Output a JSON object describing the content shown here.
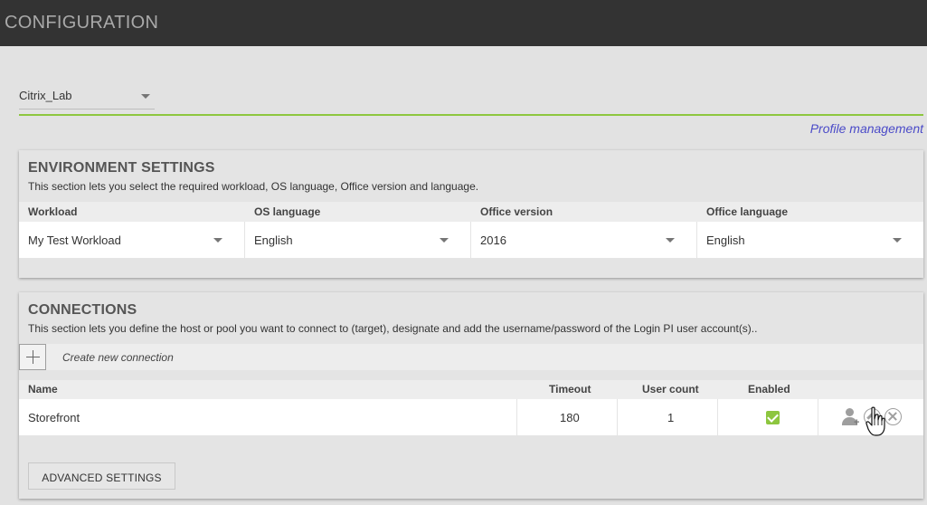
{
  "app": {
    "title": "CONFIGURATION"
  },
  "profile": {
    "selected": "Citrix_Lab",
    "management_link": "Profile management"
  },
  "environment": {
    "title": "ENVIRONMENT SETTINGS",
    "description": "This section lets you select the required workload, OS language, Office version and language.",
    "fields": [
      {
        "label": "Workload",
        "value": "My Test Workload"
      },
      {
        "label": "OS language",
        "value": "English"
      },
      {
        "label": "Office version",
        "value": "2016"
      },
      {
        "label": "Office language",
        "value": "English"
      }
    ]
  },
  "connections": {
    "title": "CONNECTIONS",
    "description": "This section lets you define the host or pool you want to connect to (target), designate and add the username/password of the Login PI user account(s)..",
    "create_label": "Create new connection",
    "columns": {
      "name": "Name",
      "timeout": "Timeout",
      "user_count": "User count",
      "enabled": "Enabled"
    },
    "rows": [
      {
        "name": "Storefront",
        "timeout": "180",
        "user_count": "1",
        "enabled": true
      }
    ],
    "advanced_label": "ADVANCED SETTINGS"
  },
  "icons": {
    "add": "plus-icon",
    "dropdown": "chevron-down-icon",
    "row_actions": [
      "add-user-icon",
      "edit-icon",
      "close-icon"
    ],
    "enabled": "check-icon"
  },
  "colors": {
    "topbar": "#333333",
    "accent": "#8dc63f",
    "link": "#4b4bc8"
  }
}
